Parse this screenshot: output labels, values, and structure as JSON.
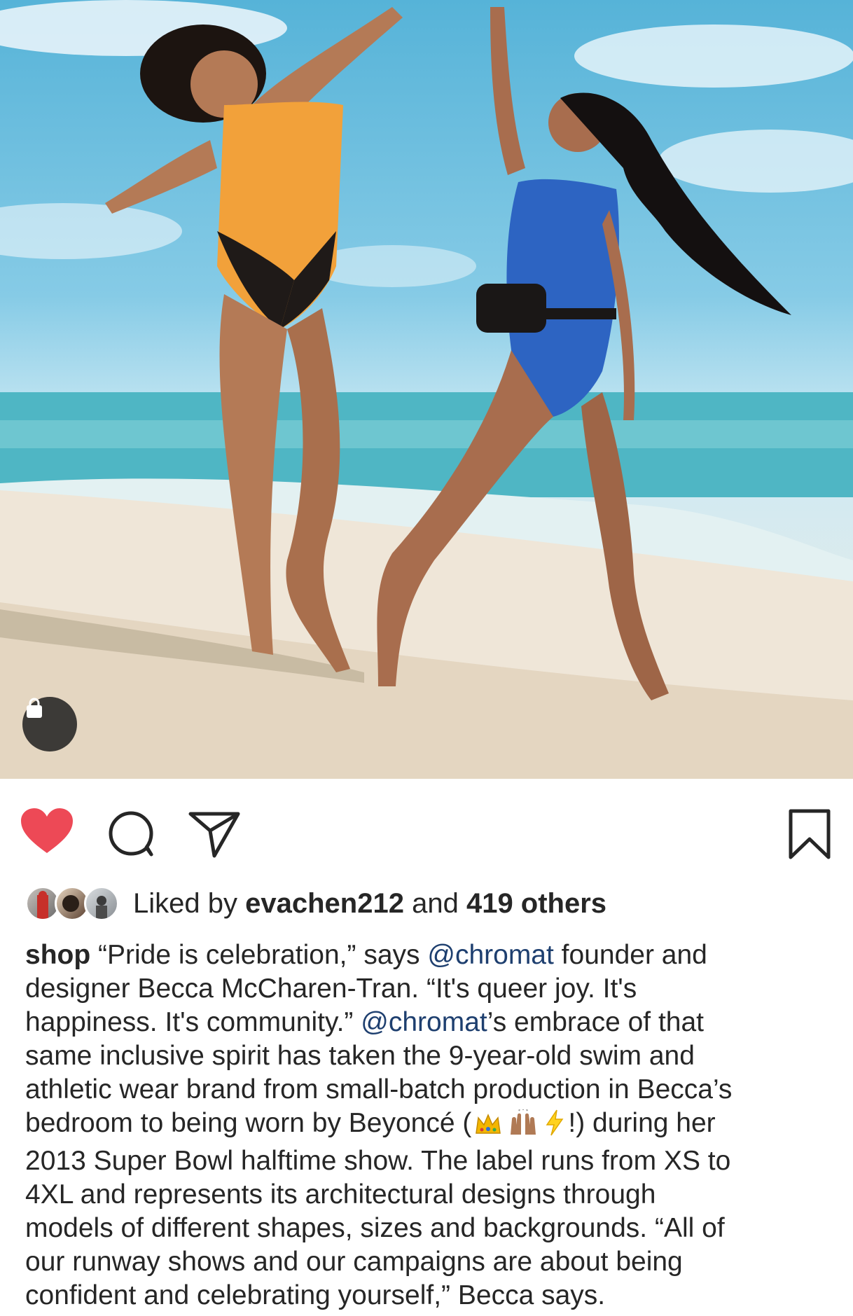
{
  "post": {
    "likes": {
      "prefix": "Liked by",
      "user": "evachen212",
      "connector": "and",
      "others": "419 others"
    },
    "caption": {
      "username": "shop",
      "lines": [
        {
          "a": " “Pride is celebration,” says ",
          "mention": "@chromat",
          "b": " founder and"
        },
        {
          "a": "designer Becca McCharen-Tran. “It's queer joy. It's"
        },
        {
          "a": "happiness. It's community.” ",
          "mention": "@chromat",
          "b": "’s embrace of that"
        },
        {
          "a": "same inclusive spirit has taken the 9-year-old swim and"
        },
        {
          "a": "athletic wear brand from small-batch production in Becca’s"
        },
        {
          "a": "bedroom to being worn by Beyoncé (",
          "emojis": [
            "crown-emoji",
            "raised-hands-emoji",
            "lightning-emoji"
          ],
          "b": "!) during her"
        },
        {
          "a": "2013 Super Bowl halftime show. The label runs from XS to"
        },
        {
          "a": "4XL and represents its architectural designs through"
        },
        {
          "a": "models of different shapes, sizes and backgrounds. “All of"
        },
        {
          "a": "our runway shows and our campaigns are about being"
        },
        {
          "a": "confident and celebrating yourself,” Becca says."
        }
      ]
    },
    "icons": {
      "like": "heart-filled-icon",
      "comment": "comment-icon",
      "share": "share-icon",
      "save": "bookmark-icon",
      "shop": "shopping-bag-icon"
    },
    "colors": {
      "heart": "#ed4956",
      "mention": "#1e3f6f",
      "text": "#262626"
    }
  }
}
